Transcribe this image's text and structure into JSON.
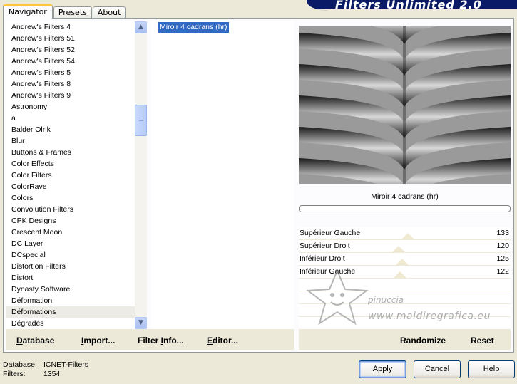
{
  "banner": {
    "title": "Filters Unlimited 2.0"
  },
  "tabs": [
    {
      "label": "Navigator",
      "active": true
    },
    {
      "label": "Presets",
      "active": false
    },
    {
      "label": "About",
      "active": false
    }
  ],
  "categories": [
    "Andrew's Filters 4",
    "Andrew's Filters 51",
    "Andrew's Filters 52",
    "Andrew's Filters 54",
    "Andrew's Filters 5",
    "Andrew's Filters 8",
    "Andrew's Filters 9",
    "Astronomy",
    "a",
    "Balder Olrik",
    "Blur",
    "Buttons & Frames",
    "Color Effects",
    "Color Filters",
    "ColorRave",
    "Colors",
    "Convolution Filters",
    "CPK Designs",
    "Crescent Moon",
    "DC Layer",
    "DCspecial",
    "Distortion Filters",
    "Distort",
    "Dynasty Software",
    "Déformation",
    "Déformations",
    "Dégradés"
  ],
  "selected_category": "Déformations",
  "filters": [
    "Miroir 4 cadrans (hr)"
  ],
  "preview": {
    "filter_name": "Miroir 4 cadrans (hr)"
  },
  "parameters": [
    {
      "label": "Supérieur Gauche",
      "value": 133
    },
    {
      "label": "Supérieur Droit",
      "value": 120
    },
    {
      "label": "Inférieur Droit",
      "value": 125
    },
    {
      "label": "Inférieur Gauche",
      "value": 122
    }
  ],
  "left_buttons": {
    "database": {
      "first": "D",
      "rest": "atabase"
    },
    "import": {
      "first": "I",
      "rest": "mport..."
    },
    "filter_info": {
      "pre": "Filter ",
      "first": "I",
      "rest": "nfo..."
    },
    "editor": {
      "first": "E",
      "rest": "ditor..."
    }
  },
  "right_buttons": {
    "randomize": "Randomize",
    "reset": "Reset"
  },
  "status": {
    "database_label": "Database:",
    "database_value": "ICNET-Filters",
    "filters_label": "Filters:",
    "filters_value": "1354"
  },
  "dialog_buttons": {
    "apply": "Apply",
    "cancel": "Cancel",
    "help": "Help"
  },
  "watermark": {
    "line1": "pinuccia",
    "line2": "www.maidiregrafica.eu"
  }
}
